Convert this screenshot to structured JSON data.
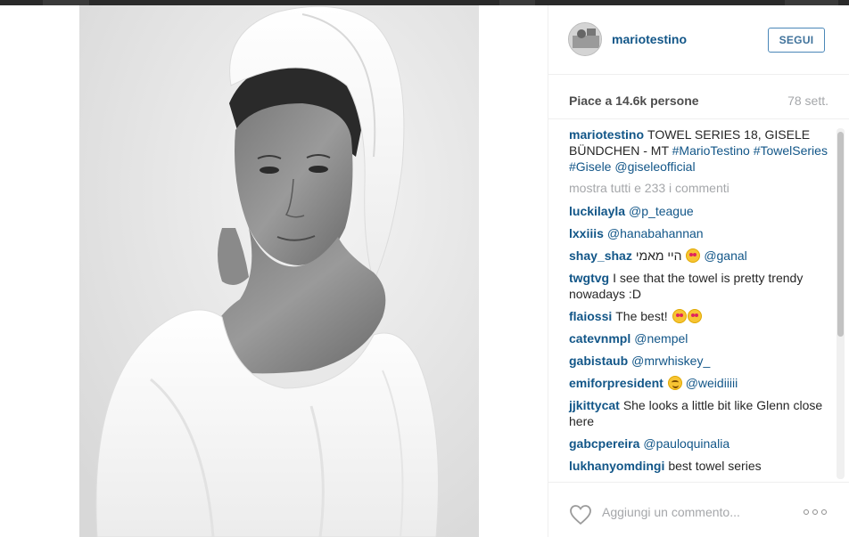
{
  "post": {
    "username": "mariotestino",
    "follow_label": "SEGUI",
    "likes_text": "Piace a 14.6k persone",
    "time_ago": "78 sett.",
    "caption": {
      "author": "mariotestino",
      "text": "TOWEL SERIES 18, GISELE BÜNDCHEN - MT ",
      "tags": [
        "#MarioTestino",
        "#TowelSeries",
        "#Gisele",
        "@giseleofficial"
      ]
    },
    "show_all_comments": "mostra tutti e 233 i commenti",
    "comments": [
      {
        "author": "luckilayla",
        "text": "",
        "mention": "@p_teague",
        "emoji": ""
      },
      {
        "author": "lxxiiis",
        "text": "",
        "mention": "@hanabahannan",
        "emoji": ""
      },
      {
        "author": "shay_shaz",
        "text": "היי מאמי",
        "mention": "@ganal",
        "emoji": "heart-eyes"
      },
      {
        "author": "twgtvg",
        "text": "I see that the towel is pretty trendy nowadays :D",
        "mention": "",
        "emoji": ""
      },
      {
        "author": "flaiossi",
        "text": "The best!",
        "mention": "",
        "emoji": "heart-eyes-2"
      },
      {
        "author": "catevnmpl",
        "text": "",
        "mention": "@nempel",
        "emoji": ""
      },
      {
        "author": "gabistaub",
        "text": "",
        "mention": "@mrwhiskey_",
        "emoji": ""
      },
      {
        "author": "emiforpresident",
        "text": "",
        "mention": "@weidiiiii",
        "emoji": "smile"
      },
      {
        "author": "jjkittycat",
        "text": "She looks a little bit like Glenn close here",
        "mention": "",
        "emoji": ""
      },
      {
        "author": "gabcpereira",
        "text": "",
        "mention": "@pauloquinalia",
        "emoji": ""
      },
      {
        "author": "lukhanyomdingi",
        "text": "best towel series",
        "mention": "",
        "emoji": ""
      }
    ],
    "comment_placeholder": "Aggiungi un commento...",
    "icons": {
      "like": "heart-icon",
      "more": "more-options-icon",
      "avatar": "avatar"
    },
    "colors": {
      "link": "#125688",
      "follow_border": "#4a87b8",
      "muted": "#a5a7aa"
    }
  }
}
